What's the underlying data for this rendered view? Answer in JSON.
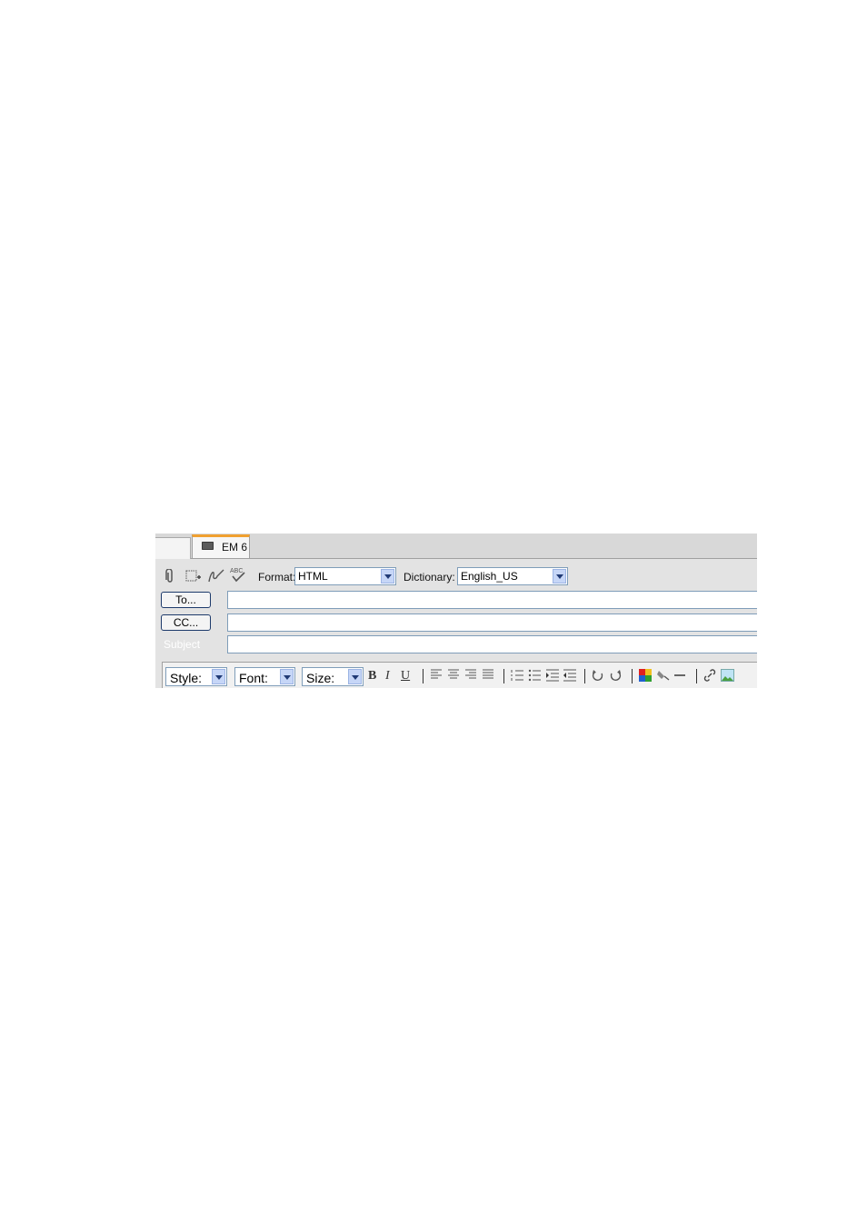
{
  "tabs": {
    "active_label": "EM 6"
  },
  "toolbar": {
    "format_label": "Format:",
    "format_value": "HTML",
    "dictionary_label": "Dictionary:",
    "dictionary_value": "English_US",
    "icons": [
      "paperclip-icon",
      "address-book-icon",
      "signature-icon",
      "spellcheck-icon"
    ]
  },
  "address": {
    "to_button": "To...",
    "cc_button": "CC...",
    "subject_label": "Subject"
  },
  "format_bar": {
    "style_value": "Style:",
    "font_value": "Font:",
    "size_value": "Size:",
    "bold": "B",
    "italic": "I",
    "underline": "U"
  },
  "colors": {
    "tab_accent": "#f0a030",
    "field_border": "#7f9db9",
    "dropdown_arrow": "#c6d6f7"
  }
}
